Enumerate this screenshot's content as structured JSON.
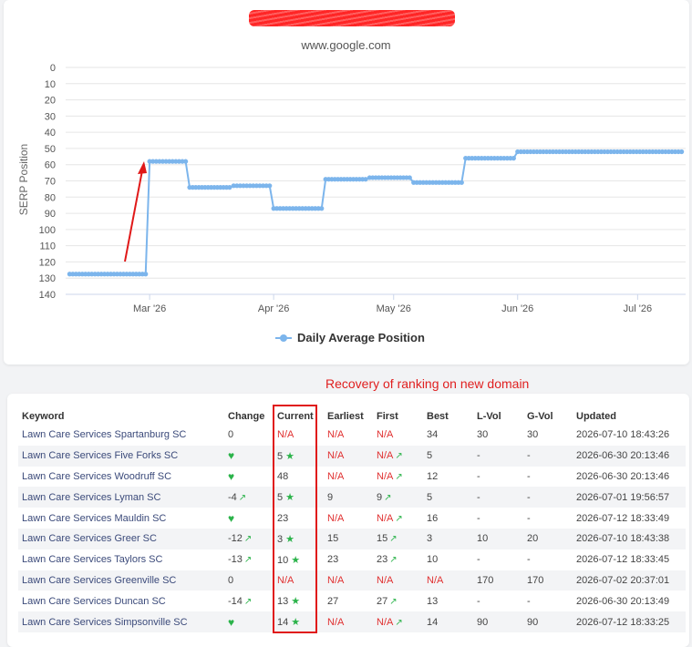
{
  "chart_data": {
    "type": "line",
    "title": "",
    "subtitle": "www.google.com",
    "ylabel": "SERP Position",
    "ylim": [
      0,
      140
    ],
    "y_reversed": true,
    "y_ticks": [
      0,
      10,
      20,
      30,
      40,
      50,
      60,
      70,
      80,
      90,
      100,
      110,
      120,
      130,
      140
    ],
    "x_tick_labels": [
      "Mar '26",
      "Apr '26",
      "May '26",
      "Jun '26",
      "Jul '26"
    ],
    "x_tick_dates": [
      "2026-03-01",
      "2026-04-01",
      "2026-05-01",
      "2026-06-01",
      "2026-07-01"
    ],
    "xlim": [
      "2026-02-08",
      "2026-07-13"
    ],
    "grid": true,
    "legend_position": "bottom",
    "series": [
      {
        "name": "Daily Average Position",
        "color": "#7cb5ec",
        "segments": [
          {
            "from": "2026-02-09",
            "to": "2026-02-28",
            "value": 127.5
          },
          {
            "from": "2026-03-01",
            "to": "2026-03-10",
            "value": 58
          },
          {
            "from": "2026-03-11",
            "to": "2026-03-21",
            "value": 74
          },
          {
            "from": "2026-03-22",
            "to": "2026-03-31",
            "value": 73
          },
          {
            "from": "2026-04-01",
            "to": "2026-04-13",
            "value": 87
          },
          {
            "from": "2026-04-14",
            "to": "2026-04-24",
            "value": 69
          },
          {
            "from": "2026-04-25",
            "to": "2026-05-05",
            "value": 68
          },
          {
            "from": "2026-05-06",
            "to": "2026-05-18",
            "value": 71
          },
          {
            "from": "2026-05-19",
            "to": "2026-05-31",
            "value": 56
          },
          {
            "from": "2026-06-01",
            "to": "2026-07-12",
            "value": 52
          }
        ]
      }
    ],
    "annotation_arrow": {
      "color": "#e01818"
    }
  },
  "legend_label": "Daily Average Position",
  "annotation_text": "Recovery of ranking on new domain",
  "table": {
    "headers": {
      "keyword": "Keyword",
      "change": "Change",
      "current": "Current",
      "earliest": "Earliest",
      "first": "First",
      "best": "Best",
      "lvol": "L-Vol",
      "gvol": "G-Vol",
      "updated": "Updated"
    },
    "rows": [
      {
        "keyword": "Lawn Care Services Spartanburg SC",
        "change": "0",
        "change_icon": "",
        "current": "N/A",
        "current_star": false,
        "earliest": "N/A",
        "first": "N/A",
        "first_up": false,
        "best": "34",
        "lvol": "30",
        "gvol": "30",
        "updated": "2026-07-10 18:43:26"
      },
      {
        "keyword": "Lawn Care Services Five Forks SC",
        "change": "",
        "change_icon": "heart-icon",
        "current": "5",
        "current_star": true,
        "earliest": "N/A",
        "first": "N/A",
        "first_up": true,
        "best": "5",
        "lvol": "-",
        "gvol": "-",
        "updated": "2026-06-30 20:13:46"
      },
      {
        "keyword": "Lawn Care Services Woodruff SC",
        "change": "",
        "change_icon": "heart-icon",
        "current": "48",
        "current_star": false,
        "earliest": "N/A",
        "first": "N/A",
        "first_up": true,
        "best": "12",
        "lvol": "-",
        "gvol": "-",
        "updated": "2026-06-30 20:13:46"
      },
      {
        "keyword": "Lawn Care Services Lyman SC",
        "change": "-4",
        "change_icon": "trend-up-icon",
        "current": "5",
        "current_star": true,
        "earliest": "9",
        "first": "9",
        "first_up": true,
        "best": "5",
        "lvol": "-",
        "gvol": "-",
        "updated": "2026-07-01 19:56:57"
      },
      {
        "keyword": "Lawn Care Services Mauldin SC",
        "change": "",
        "change_icon": "heart-icon",
        "current": "23",
        "current_star": false,
        "earliest": "N/A",
        "first": "N/A",
        "first_up": true,
        "best": "16",
        "lvol": "-",
        "gvol": "-",
        "updated": "2026-07-12 18:33:49"
      },
      {
        "keyword": "Lawn Care Services Greer SC",
        "change": "-12",
        "change_icon": "trend-up-icon",
        "current": "3",
        "current_star": true,
        "earliest": "15",
        "first": "15",
        "first_up": true,
        "best": "3",
        "lvol": "10",
        "gvol": "20",
        "updated": "2026-07-10 18:43:38"
      },
      {
        "keyword": "Lawn Care Services Taylors SC",
        "change": "-13",
        "change_icon": "trend-up-icon",
        "current": "10",
        "current_star": true,
        "earliest": "23",
        "first": "23",
        "first_up": true,
        "best": "10",
        "lvol": "-",
        "gvol": "-",
        "updated": "2026-07-12 18:33:45"
      },
      {
        "keyword": "Lawn Care Services Greenville SC",
        "change": "0",
        "change_icon": "",
        "current": "N/A",
        "current_star": false,
        "earliest": "N/A",
        "first": "N/A",
        "first_up": false,
        "best": "N/A",
        "lvol": "170",
        "gvol": "170",
        "updated": "2026-07-02 20:37:01"
      },
      {
        "keyword": "Lawn Care Services Duncan SC",
        "change": "-14",
        "change_icon": "trend-up-icon",
        "current": "13",
        "current_star": true,
        "earliest": "27",
        "first": "27",
        "first_up": true,
        "best": "13",
        "lvol": "-",
        "gvol": "-",
        "updated": "2026-06-30 20:13:49"
      },
      {
        "keyword": "Lawn Care Services Simpsonville SC",
        "change": "",
        "change_icon": "heart-icon",
        "current": "14",
        "current_star": true,
        "earliest": "N/A",
        "first": "N/A",
        "first_up": true,
        "best": "14",
        "lvol": "90",
        "gvol": "90",
        "updated": "2026-07-12 18:33:25"
      }
    ]
  }
}
